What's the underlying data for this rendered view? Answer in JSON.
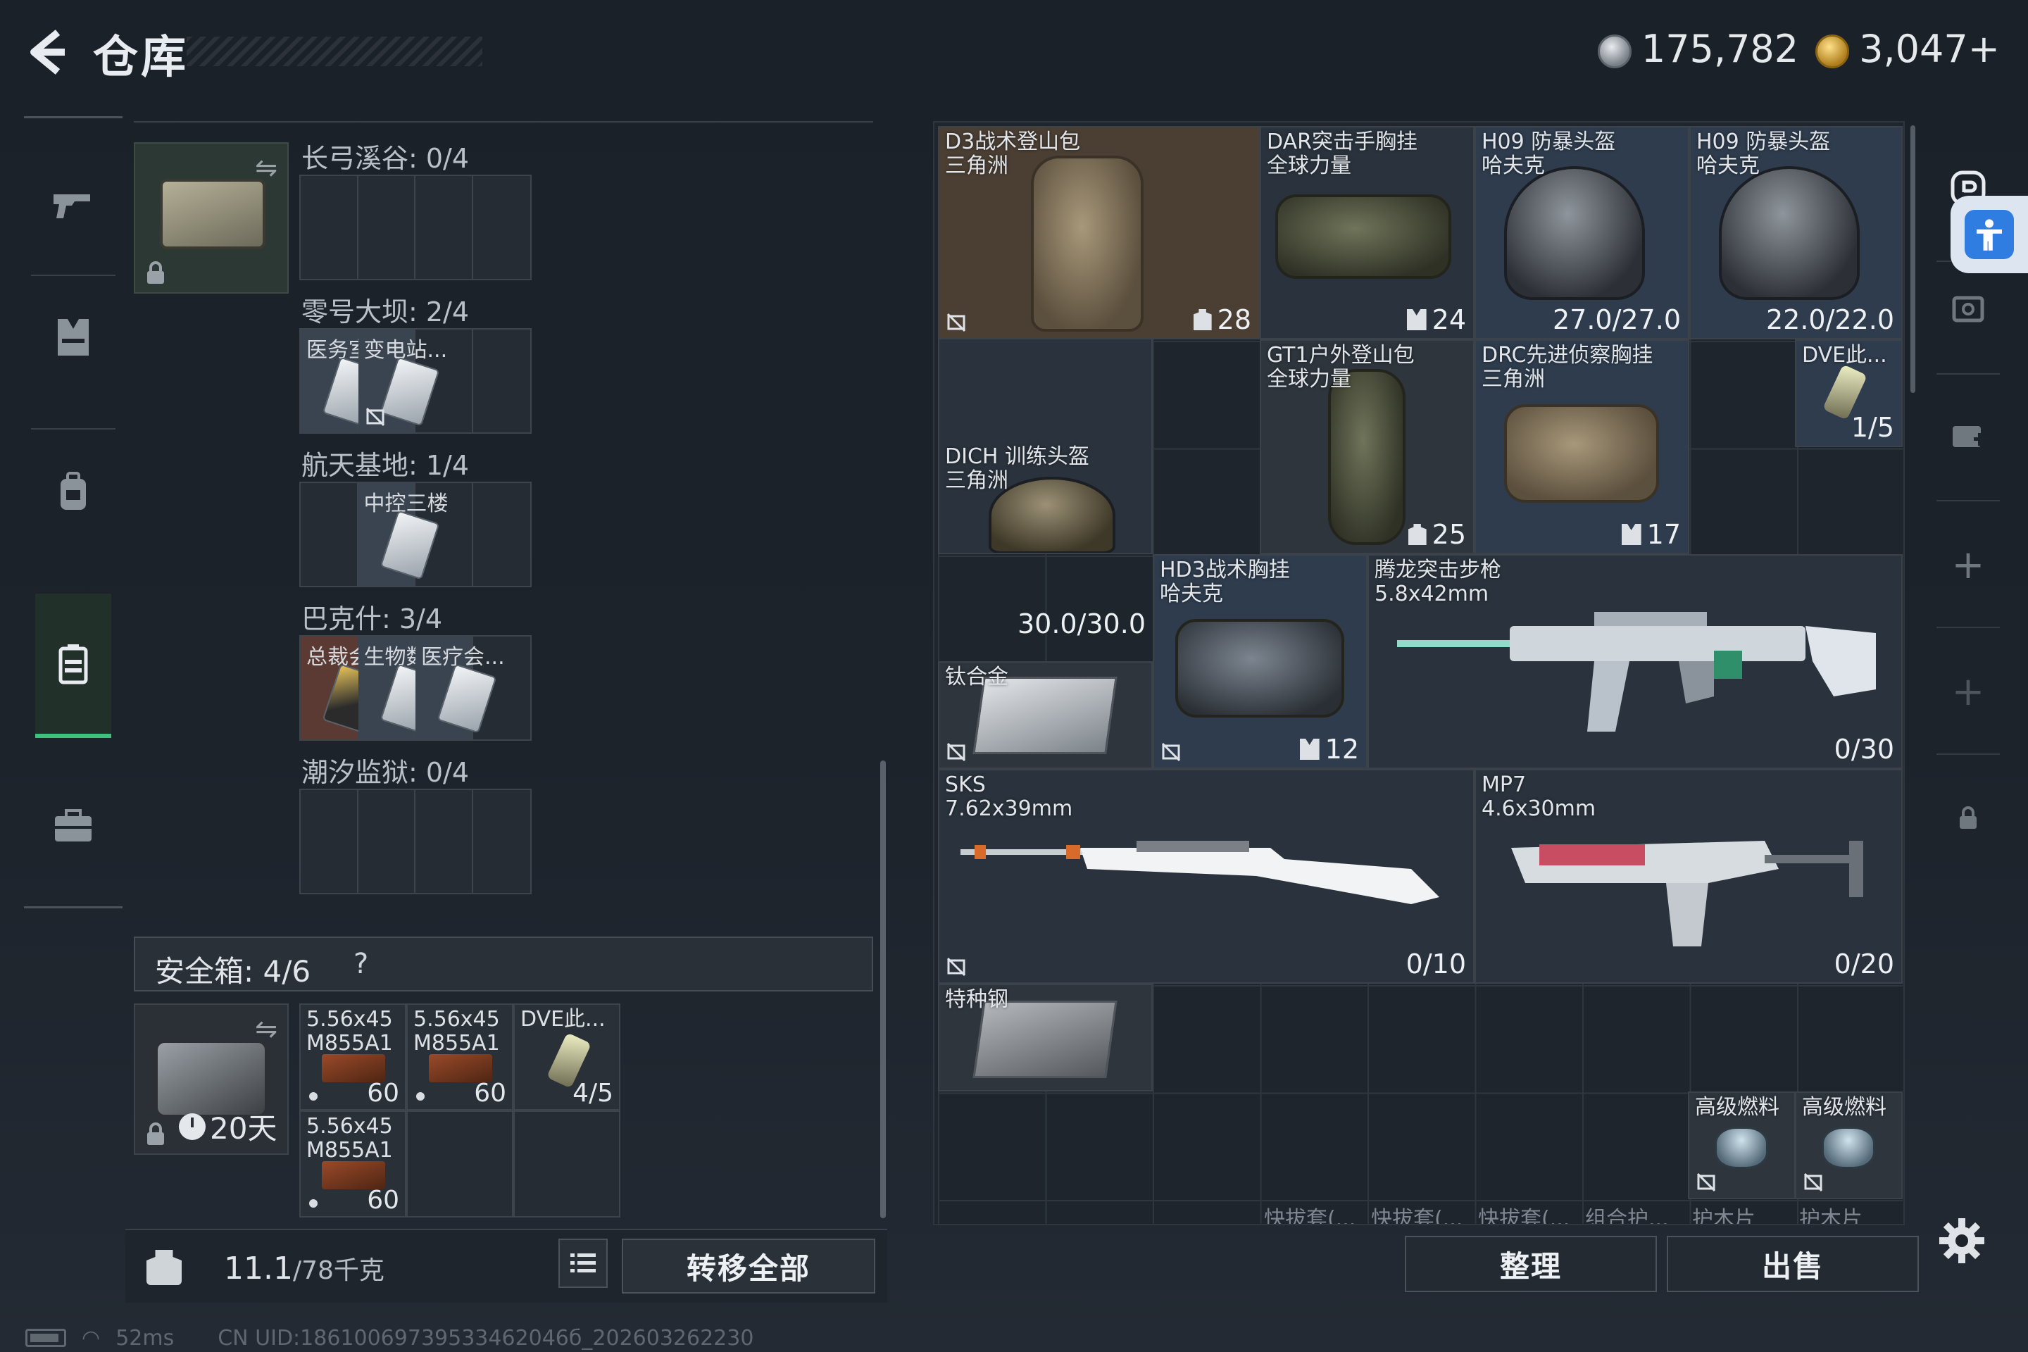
{
  "header": {
    "title": "仓库"
  },
  "currency": {
    "silver": "175,782",
    "gold": "3,047+"
  },
  "left_nav": [
    {
      "id": "weapons",
      "icon": "gun-icon"
    },
    {
      "id": "vest",
      "icon": "vest-icon"
    },
    {
      "id": "backpack",
      "icon": "backpack-icon"
    },
    {
      "id": "case",
      "icon": "case-icon",
      "active": true
    },
    {
      "id": "briefcase",
      "icon": "briefcase-icon"
    }
  ],
  "keycase": {
    "regions": [
      {
        "label": "长弓溪谷: 0/4",
        "cards": []
      },
      {
        "label": "零号大坝: 2/4",
        "cards": [
          {
            "name": "医务室",
            "tone": "silver"
          },
          {
            "name": "变电站...",
            "tone": "silver",
            "no_trade": true
          }
        ]
      },
      {
        "label": "航天基地: 1/4",
        "cards": [
          null,
          {
            "name": "中控三楼",
            "tone": "silver"
          }
        ]
      },
      {
        "label": "巴克什: 3/4",
        "cards": [
          {
            "name": "总裁会...",
            "tone": "gold"
          },
          {
            "name": "生物数...",
            "tone": "silver"
          },
          {
            "name": "医疗会...",
            "tone": "silver"
          }
        ]
      },
      {
        "label": "潮汐监狱: 0/4",
        "cards": []
      }
    ]
  },
  "safebox": {
    "title": "安全箱:  4/6",
    "help": "?",
    "timer": "20天",
    "slots": [
      {
        "name": "5.56x45\nM855A1",
        "count": "60"
      },
      {
        "name": "5.56x45\nM855A1",
        "count": "60"
      },
      {
        "name": "DVE此...",
        "count": "4/5"
      },
      {
        "name": "5.56x45\nM855A1",
        "count": "60"
      }
    ]
  },
  "weight": {
    "current": "11.1",
    "max": "/78千克"
  },
  "buttons": {
    "transfer_all": "转移全部",
    "sort": "整理",
    "sell": "出售"
  },
  "stash_items": [
    {
      "id": "d3",
      "name": "D3战术登山包\n三角洲",
      "value": "28",
      "badge": "backpack"
    },
    {
      "id": "dar",
      "name": "DAR突击手胸挂\n全球力量",
      "value": "24",
      "badge": "vest"
    },
    {
      "id": "h09a",
      "name": "H09 防暴头盔\n哈夫克",
      "value": "27.0/27.0"
    },
    {
      "id": "h09b",
      "name": "H09 防暴头盔\n哈夫克",
      "value": "22.0/22.0"
    },
    {
      "id": "gt1",
      "name": "GT1户外登山包\n全球力量",
      "value": "25",
      "badge": "backpack"
    },
    {
      "id": "drc",
      "name": "DRC先进侦察胸挂\n三角洲",
      "value": "17",
      "badge": "vest"
    },
    {
      "id": "dve",
      "name": "DVE此...",
      "value": "1/5"
    },
    {
      "id": "dich",
      "name": "DICH 训练头盔\n三角洲",
      "value": "30.0/30.0"
    },
    {
      "id": "hd3",
      "name": "HD3战术胸挂\n哈夫克",
      "value": "12",
      "badge": "vest"
    },
    {
      "id": "tenglong",
      "name": "腾龙突击步枪\n5.8x42mm",
      "value": "0/30"
    },
    {
      "id": "titanium",
      "name": "钛合金",
      "value": ""
    },
    {
      "id": "sks",
      "name": "SKS\n7.62x39mm",
      "value": "0/10"
    },
    {
      "id": "mp7",
      "name": "MP7\n4.6x30mm",
      "value": "0/20"
    },
    {
      "id": "steel",
      "name": "特种钢",
      "value": ""
    },
    {
      "id": "fuel1",
      "name": "高级燃料",
      "value": ""
    },
    {
      "id": "fuel2",
      "name": "高级燃料",
      "value": ""
    }
  ],
  "stash_footer_labels": [
    "快拔套(...",
    "快拔套(...",
    "快拔套(...",
    "组合护...",
    "护木片",
    "护木片"
  ],
  "status": {
    "ping": "52ms",
    "uid": "CN UID:18610069739533462046б_202603262230"
  },
  "colors": {
    "accent_green": "#3ec27a",
    "accessibility_blue": "#2f7de1"
  }
}
